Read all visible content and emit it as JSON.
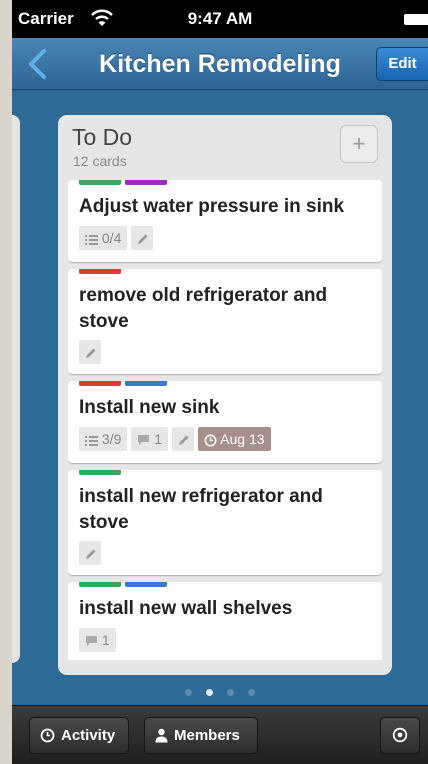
{
  "status_bar": {
    "carrier": "Carrier",
    "time": "9:47 AM"
  },
  "nav": {
    "title": "Kitchen Remodeling",
    "edit_label": "Edit"
  },
  "list": {
    "title": "To Do",
    "count": "12 cards",
    "add_label": "+",
    "cards": [
      {
        "title": "Adjust water pressure in sink",
        "labels": [
          "#3aa55d",
          "#9b2fc2"
        ],
        "checklist": "0/4",
        "comments": "",
        "edit_icon": true,
        "due": ""
      },
      {
        "title": "remove old refrigerator and stove",
        "labels": [
          "#d63e3e"
        ],
        "checklist": "",
        "comments": "",
        "edit_icon": true,
        "due": ""
      },
      {
        "title": "Install new sink",
        "labels": [
          "#d63e3e",
          "#3a78c9"
        ],
        "checklist": "3/9",
        "comments": "1",
        "edit_icon": true,
        "due": "Aug 13"
      },
      {
        "title": "install new refrigerator and stove",
        "labels": [
          "#3aa55d"
        ],
        "checklist": "",
        "comments": "",
        "edit_icon": true,
        "due": ""
      },
      {
        "title": "install new wall shelves",
        "labels": [
          "#3aa55d",
          "#3a78c9"
        ],
        "checklist": "",
        "comments": "1",
        "edit_icon": false,
        "due": ""
      }
    ]
  },
  "pagination": {
    "pages": 4,
    "current_index": 1
  },
  "toolbar": {
    "activity_label": "Activity",
    "members_label": "Members"
  },
  "colors": {
    "background": "#2e6a96",
    "nav": "#3a75a6",
    "edit_button": "#2a7acb",
    "due_badge": "#a98f8b"
  }
}
